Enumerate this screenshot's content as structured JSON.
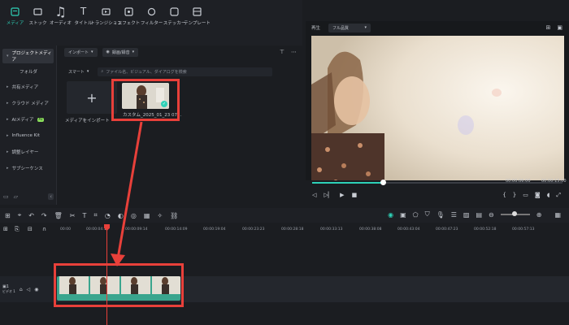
{
  "toolbar": {
    "items": [
      {
        "label": "メディア",
        "icon": "media-icon",
        "active": true
      },
      {
        "label": "ストック",
        "icon": "stock-icon"
      },
      {
        "label": "オーディオ",
        "icon": "audio-icon"
      },
      {
        "label": "タイトル",
        "icon": "title-icon"
      },
      {
        "label": "トランジション",
        "icon": "transition-icon"
      },
      {
        "label": "エフェクト",
        "icon": "effect-icon"
      },
      {
        "label": "フィルター",
        "icon": "filter-icon"
      },
      {
        "label": "ステッカー",
        "icon": "sticker-icon"
      },
      {
        "label": "テンプレート",
        "icon": "template-icon"
      }
    ]
  },
  "sidebar": {
    "project_media": "プロジェクトメディア",
    "folder": "フォルダ",
    "items": [
      {
        "label": "共有メディア"
      },
      {
        "label": "クラウド メディア"
      },
      {
        "label": "AIメディア",
        "badge": "AI"
      },
      {
        "label": "Influence Kit"
      },
      {
        "label": "調整レイヤー"
      },
      {
        "label": "サブシーケンス"
      }
    ]
  },
  "media": {
    "import_label": "インポート",
    "record_label": "録画/録音",
    "smart_label": "スマート",
    "search_placeholder": "ファイル名、ビジュアル、ダイアログを検索",
    "import_media_label": "メディアをインポート",
    "clip_name": "カスタム_2025_01_23 07..."
  },
  "preview": {
    "play_label": "再生",
    "quality_label": "フル品質",
    "current_time": "00:00:06:00",
    "total_time": "00:00:15:00"
  },
  "ruler": {
    "ticks": [
      "00:00",
      "00:00:04:19",
      "00:00:09:14",
      "00:00:14:09",
      "00:00:19:04",
      "00:00:23:23",
      "00:00:28:18",
      "00:00:33:13",
      "00:00:38:08",
      "00:00:43:04",
      "00:00:47:23",
      "00:00:52:18",
      "00:00:57:13"
    ]
  },
  "track": {
    "label": "ビデオ 1",
    "index": "1"
  },
  "colors": {
    "accent": "#2ed1b7",
    "highlight": "#e8403a",
    "clip_track": "#3aa58e"
  }
}
